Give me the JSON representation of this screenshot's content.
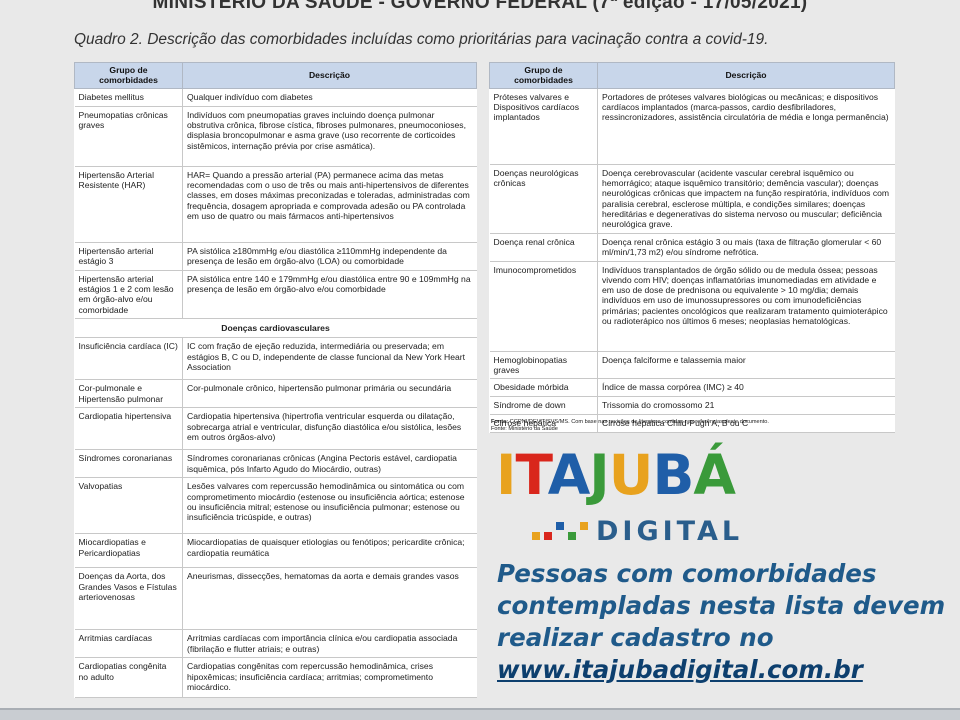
{
  "header": {
    "top_line": "MINISTÉRIO DA SAÚDE - GOVERNO FEDERAL (7ª edição - 17/05/2021)",
    "subtitle": "Quadro 2. Descrição das comorbidades incluídas como prioritárias para vacinação contra a covid-19."
  },
  "left_table": {
    "col_group": "Grupo de comorbidades",
    "col_desc": "Descrição",
    "rows": [
      {
        "group": "Diabetes mellitus",
        "desc": "Qualquer indivíduo com diabetes"
      },
      {
        "group": "Pneumopatias crônicas graves",
        "desc": "Indivíduos com pneumopatias graves incluindo doença pulmonar obstrutiva crônica, fibrose cística, fibroses pulmonares, pneumoconioses, displasia broncopulmonar e asma grave (uso recorrente de corticoides sistêmicos, internação prévia por crise asmática)."
      },
      {
        "group": "Hipertensão Arterial Resistente (HAR)",
        "desc": "HAR= Quando a pressão arterial (PA) permanece acima das metas recomendadas com o uso de três ou mais anti-hipertensivos de diferentes classes, em doses máximas preconizadas e toleradas, administradas com frequência, dosagem apropriada e comprovada adesão ou PA controlada em uso de quatro ou mais fármacos anti-hipertensivos"
      },
      {
        "group": "Hipertensão arterial estágio 3",
        "desc": "PA sistólica ≥180mmHg e/ou diastólica ≥110mmHg independente da presença de lesão em órgão-alvo (LOA) ou comorbidade"
      },
      {
        "group": "Hipertensão arterial estágios 1 e 2 com lesão em órgão-alvo e/ou comorbidade",
        "desc": "PA sistólica entre 140 e 179mmHg e/ou diastólica entre 90 e 109mmHg na presença de lesão em órgão-alvo e/ou comorbidade"
      }
    ],
    "section_title": "Doenças cardiovasculares",
    "rows2": [
      {
        "group": "Insuficiência cardíaca (IC)",
        "desc": "IC com fração de ejeção reduzida, intermediária ou preservada; em estágios B, C ou D, independente de classe funcional da New York Heart Association"
      },
      {
        "group": "Cor-pulmonale e Hipertensão pulmonar",
        "desc": "Cor-pulmonale crônico, hipertensão pulmonar primária ou secundária"
      },
      {
        "group": "Cardiopatia hipertensiva",
        "desc": "Cardiopatia hipertensiva (hipertrofia ventricular esquerda ou dilatação, sobrecarga atrial e ventricular, disfunção diastólica e/ou sistólica, lesões em outros órgãos-alvo)"
      },
      {
        "group": "Síndromes coronarianas",
        "desc": "Síndromes coronarianas crônicas (Angina Pectoris estável, cardiopatia isquêmica, pós Infarto Agudo do Miocárdio, outras)"
      },
      {
        "group": "Valvopatias",
        "desc": "Lesões valvares com repercussão hemodinâmica ou sintomática ou com comprometimento miocárdio (estenose ou insuficiência aórtica; estenose ou insuficiência mitral; estenose ou insuficiência pulmonar; estenose ou insuficiência tricúspide, e outras)"
      },
      {
        "group": "Miocardiopatias e Pericardiopatias",
        "desc": "Miocardiopatias de quaisquer etiologias ou fenótipos; pericardite crônica; cardiopatia reumática"
      },
      {
        "group": "Doenças da Aorta, dos Grandes Vasos e Fístulas arteriovenosas",
        "desc": "Aneurismas, dissecções, hematomas da aorta e demais grandes vasos"
      },
      {
        "group": "Arritmias cardíacas",
        "desc": "Arritmias cardíacas com importância clínica e/ou cardiopatia associada (fibrilação e flutter atriais; e outras)"
      },
      {
        "group": "Cardiopatias congênita no adulto",
        "desc": "Cardiopatias congênitas com repercussão hemodinâmica, crises hipoxêmicas; insuficiência cardíaca; arritmias; comprometimento miocárdico."
      }
    ]
  },
  "right_table": {
    "col_group": "Grupo de comorbidades",
    "col_desc": "Descrição",
    "rows": [
      {
        "group": "Próteses valvares e Dispositivos cardíacos implantados",
        "desc": "Portadores de próteses valvares biológicas ou mecânicas; e dispositivos cardíacos implantados (marca-passos, cardio desfibriladores, ressincronizadores, assistência circulatória de média e longa permanência)"
      },
      {
        "group": "Doenças neurológicas crônicas",
        "desc": "Doença cerebrovascular (acidente vascular cerebral isquêmico ou hemorrágico; ataque isquêmico transitório; demência vascular); doenças neurológicas crônicas que impactem na função respiratória, indivíduos com paralisia cerebral, esclerose múltipla, e condições similares; doenças hereditárias e degenerativas do sistema nervoso ou muscular; deficiência neurológica grave."
      },
      {
        "group": "Doença renal crônica",
        "desc": "Doença renal crônica estágio 3 ou mais (taxa de filtração glomerular < 60 ml/min/1,73 m2) e/ou síndrome nefrótica."
      },
      {
        "group": "Imunocomprometidos",
        "desc": "Indivíduos transplantados de órgão sólido ou de medula óssea; pessoas vivendo com HIV; doenças inflamatórias imunomediadas em atividade e em uso de dose de prednisona ou equivalente > 10 mg/dia; demais indivíduos em uso de imunossupressores ou com imunodeficiências primárias; pacientes oncológicos que realizaram tratamento quimioterápico ou radioterápico nos últimos 6 meses; neoplasias hematológicas."
      },
      {
        "group": "Hemoglobinopatias graves",
        "desc": "Doença falciforme e talassemia maior"
      },
      {
        "group": "Obesidade mórbida",
        "desc": "Índice de massa corpórea (IMC) ≥ 40"
      },
      {
        "group": "Síndrome de down",
        "desc": "Trissomia do cromossomo 21"
      },
      {
        "group": "Cirrose hepática",
        "desc": "Cirrose hepática Child-Pugh A, B ou C"
      }
    ],
    "source_label": "Fonte:",
    "source_text": "CGPNI/DEVIT/SVS/MS. Com base nas revisões de literatura contidas nas referências deste documento.",
    "source_line2": "Fonte: Ministério da Saúde"
  },
  "logo": {
    "letters": [
      {
        "ch": "I",
        "color": "#e8a21e"
      },
      {
        "ch": "T",
        "color": "#d9261c"
      },
      {
        "ch": "A",
        "color": "#1f5ea8"
      },
      {
        "ch": "J",
        "color": "#3a9a3a"
      },
      {
        "ch": "U",
        "color": "#e8a21e"
      },
      {
        "ch": "B",
        "color": "#1f5ea8"
      },
      {
        "ch": "Á",
        "color": "#3a9a3a"
      }
    ],
    "subtitle": "DIGITAL"
  },
  "message": {
    "line1": "Pessoas com comorbidades",
    "line2": "contempladas nesta lista devem",
    "line3": "realizar cadastro no",
    "url": "www.itajubadigital.com.br"
  }
}
